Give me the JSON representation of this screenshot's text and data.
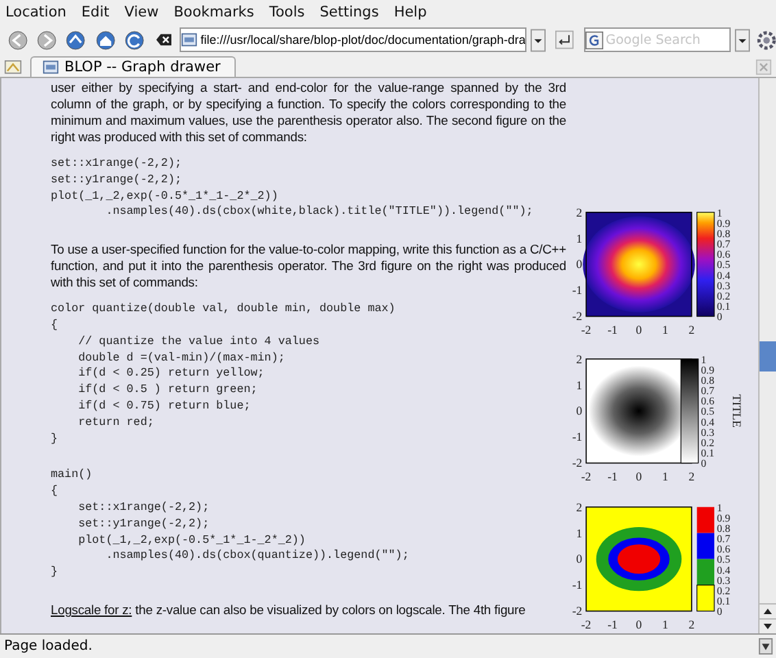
{
  "menu": [
    {
      "label": "Location"
    },
    {
      "label": "Edit"
    },
    {
      "label": "View"
    },
    {
      "label": "Bookmarks"
    },
    {
      "label": "Tools"
    },
    {
      "label": "Settings"
    },
    {
      "label": "Help"
    }
  ],
  "nav_buttons": [
    {
      "kind": "back",
      "disabled": true
    },
    {
      "kind": "forward",
      "disabled": true
    },
    {
      "kind": "up",
      "disabled": false
    },
    {
      "kind": "home",
      "disabled": false
    },
    {
      "kind": "reload",
      "disabled": false
    },
    {
      "kind": "stop",
      "disabled": false
    }
  ],
  "address": {
    "value": "file:///usr/local/share/blop-plot/doc/documentation/graph-dra"
  },
  "search": {
    "placeholder": "Google Search"
  },
  "tabs": [
    {
      "label": "BLOP -- Graph drawer",
      "selected": true
    }
  ],
  "content": {
    "blocks": [
      {
        "kind": "paragraph",
        "text": "user either by specifying a start- and end-color for the value-range spanned by the 3rd column of the graph, or by specifying a function. To specify the colors corresponding to the minimum and maximum values, use the parenthesis operator also. The second figure on the right was produced with this set of commands:"
      },
      {
        "kind": "code",
        "lines": [
          "set::x1range(-2,2);",
          "set::y1range(-2,2);",
          "plot(_1,_2,exp(-0.5*_1*_1-_2*_2))",
          "        .nsamples(40).ds(cbox(white,black).title(\"TITLE\")).legend(\"\");"
        ]
      },
      {
        "kind": "paragraph",
        "text": "To use a user-specified function for the value-to-color mapping, write this function as a C/C++ function, and put it into the parenthesis operator. The 3rd figure on the right was produced with this set of commands:"
      },
      {
        "kind": "code",
        "lines": [
          "color quantize(double val, double min, double max)",
          "{",
          "    // quantize the value into 4 values",
          "    double d =(val-min)/(max-min);",
          "    if(d < 0.25) return yellow;",
          "    if(d < 0.5 ) return green;",
          "    if(d < 0.75) return blue;",
          "    return red;",
          "}"
        ]
      },
      {
        "kind": "code",
        "lines": [
          "main()",
          "{",
          "    set::x1range(-2,2);",
          "    set::y1range(-2,2);",
          "    plot(_1,_2,exp(-0.5*_1*_1-_2*_2))",
          "        .nsamples(40).ds(cbox(quantize)).legend(\"\");",
          "}"
        ]
      },
      {
        "kind": "paragraph",
        "link": "Logscale for z:",
        "text": " the z-value can also be visualized by colors on logscale. The 4th figure"
      }
    ],
    "figures": [
      {
        "kind": "hot",
        "x_ticks": [
          "-2",
          "-1",
          "0",
          "1",
          "2"
        ],
        "y_ticks": [
          "2",
          "1",
          "0",
          "-1",
          "-2"
        ],
        "colorbar_ticks": [
          "1",
          "0.9",
          "0.8",
          "0.7",
          "0.6",
          "0.5",
          "0.4",
          "0.3",
          "0.2",
          "0.1",
          "0"
        ]
      },
      {
        "kind": "gray",
        "x_ticks": [
          "-2",
          "-1",
          "0",
          "1",
          "2"
        ],
        "y_ticks": [
          "2",
          "1",
          "0",
          "-1",
          "-2"
        ],
        "colorbar_ticks": [
          "1",
          "0.9",
          "0.8",
          "0.7",
          "0.6",
          "0.5",
          "0.4",
          "0.3",
          "0.2",
          "0.1",
          "0"
        ],
        "colorbar_title": "TITLE"
      },
      {
        "kind": "quantized",
        "x_ticks": [
          "-2",
          "-1",
          "0",
          "1",
          "2"
        ],
        "y_ticks": [
          "2",
          "1",
          "0",
          "-1",
          "-2"
        ],
        "colorbar_ticks": [
          "1",
          "0.9",
          "0.8",
          "0.7",
          "0.6",
          "0.5",
          "0.4",
          "0.3",
          "0.2",
          "0.1",
          "0"
        ]
      }
    ]
  },
  "status_bar": {
    "text": "Page loaded."
  }
}
